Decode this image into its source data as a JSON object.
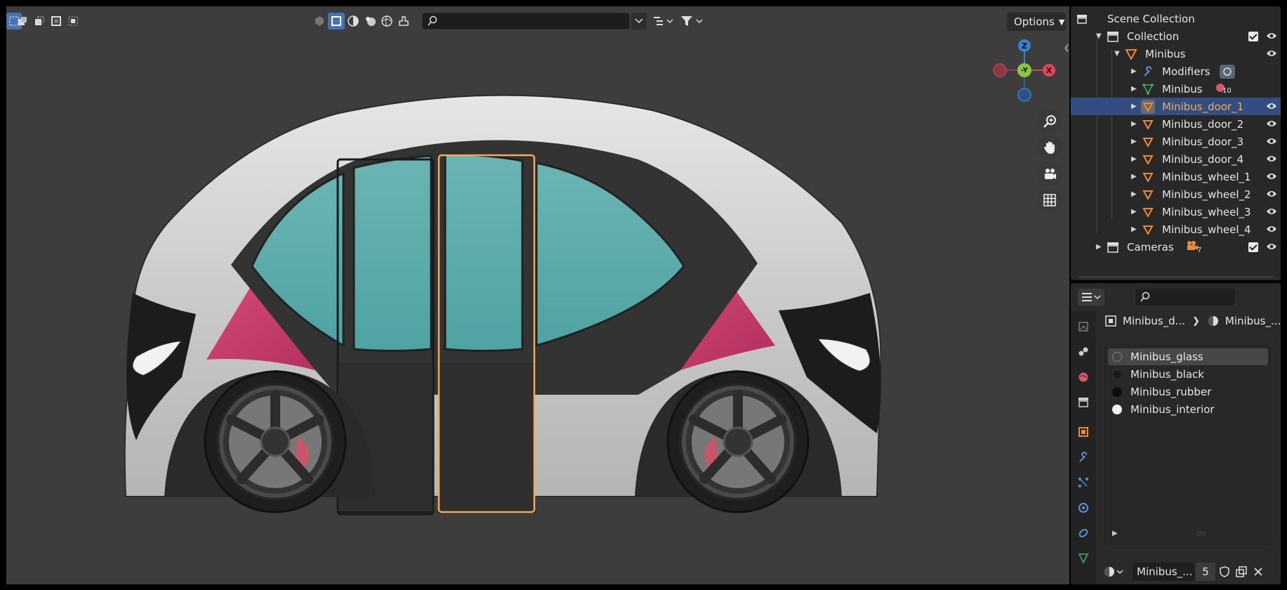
{
  "viewport": {
    "header": {
      "search_placeholder": "",
      "options_label": "Options"
    },
    "gizmo": {
      "z": "Z",
      "y": "-Y",
      "x": "X"
    }
  },
  "outliner": {
    "rows": [
      {
        "label": "Scene Collection"
      },
      {
        "label": "Collection"
      },
      {
        "label": "Minibus"
      },
      {
        "label": "Modifiers"
      },
      {
        "label": "Minibus",
        "badge": "10"
      },
      {
        "label": "Minibus_door_1"
      },
      {
        "label": "Minibus_door_2"
      },
      {
        "label": "Minibus_door_3"
      },
      {
        "label": "Minibus_door_4"
      },
      {
        "label": "Minibus_wheel_1"
      },
      {
        "label": "Minibus_wheel_2"
      },
      {
        "label": "Minibus_wheel_3"
      },
      {
        "label": "Minibus_wheel_4"
      },
      {
        "label": "Cameras",
        "badge": "7"
      }
    ]
  },
  "properties": {
    "search_placeholder": "",
    "breadcrumb": {
      "object": "Minibus_d...",
      "material": "Minibus_..."
    },
    "materials": [
      {
        "name": "Minibus_glass",
        "color": "#9a9a9a"
      },
      {
        "name": "Minibus_black",
        "color": "#1a1a1a"
      },
      {
        "name": "Minibus_rubber",
        "color": "#0e0e0e"
      },
      {
        "name": "Minibus_interior",
        "color": "#f2f2f2"
      }
    ],
    "footer": {
      "material_name": "Minibus_...",
      "users": "5"
    }
  },
  "colors": {
    "accent_blue": "#4772b3",
    "selection_row": "#334d80",
    "highlight_orange": "#f4a95a",
    "object_orange": "#e98b3a",
    "glass_teal": "#62b0ad",
    "body_magenta": "#c73a6c"
  }
}
